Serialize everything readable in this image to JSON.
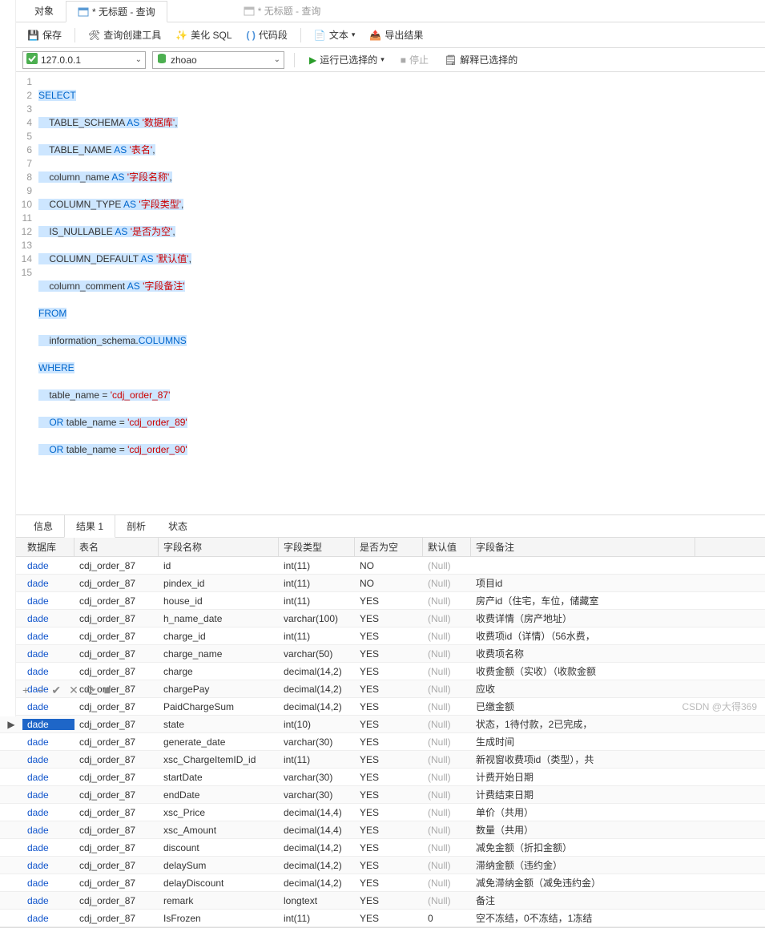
{
  "tabs": {
    "object": "对象",
    "active": "* 无标题 - 查询",
    "inactive": "* 无标题 - 查询"
  },
  "toolbar": {
    "save": "保存",
    "query_builder": "查询创建工具",
    "beautify": "美化 SQL",
    "snippet": "代码段",
    "text": "文本",
    "export": "导出结果"
  },
  "conn": {
    "host": "127.0.0.1",
    "db": "zhoao",
    "run": "运行已选择的",
    "stop": "停止",
    "explain": "解释已选择的"
  },
  "sql": {
    "l1": "SELECT",
    "l2_a": "TABLE_SCHEMA",
    "l2_b": "AS",
    "l2_c": "'数据库'",
    "l3_a": "TABLE_NAME",
    "l3_b": "AS",
    "l3_c": "'表名'",
    "l4_a": "column_name",
    "l4_b": "AS",
    "l4_c": "'字段名称'",
    "l5_a": "COLUMN_TYPE",
    "l5_b": "AS",
    "l5_c": "'字段类型'",
    "l6_a": "IS_NULLABLE",
    "l6_b": "AS",
    "l6_c": "'是否为空'",
    "l7_a": "COLUMN_DEFAULT",
    "l7_b": "AS",
    "l7_c": "'默认值'",
    "l8_a": "column_comment",
    "l8_b": "AS",
    "l8_c": "'字段备注'",
    "l9": "FROM",
    "l10_a": "information_schema",
    "l10_b": "COLUMNS",
    "l11": "WHERE",
    "l12_a": "table_name =",
    "l12_b": "'cdj_order_87'",
    "l13_a": "OR",
    "l13_b": "table_name =",
    "l13_c": "'cdj_order_89'",
    "l14_a": "OR",
    "l14_b": "table_name =",
    "l14_c": "'cdj_order_90'"
  },
  "rtabs": {
    "info": "信息",
    "result": "结果 1",
    "profile": "剖析",
    "status": "状态"
  },
  "headers": {
    "c0": "数据库",
    "c1": "表名",
    "c2": "字段名称",
    "c3": "字段类型",
    "c4": "是否为空",
    "c5": "默认值",
    "c6": "字段备注"
  },
  "null_label": "(Null)",
  "rows": [
    {
      "db": "dade",
      "t": "cdj_order_87",
      "f": "id",
      "ty": "int(11)",
      "n": "NO",
      "d": null,
      "c": ""
    },
    {
      "db": "dade",
      "t": "cdj_order_87",
      "f": "pindex_id",
      "ty": "int(11)",
      "n": "NO",
      "d": null,
      "c": "项目id"
    },
    {
      "db": "dade",
      "t": "cdj_order_87",
      "f": "house_id",
      "ty": "int(11)",
      "n": "YES",
      "d": null,
      "c": "房产id（住宅，车位，储藏室"
    },
    {
      "db": "dade",
      "t": "cdj_order_87",
      "f": "h_name_date",
      "ty": "varchar(100)",
      "n": "YES",
      "d": null,
      "c": "收费详情（房产地址）"
    },
    {
      "db": "dade",
      "t": "cdj_order_87",
      "f": "charge_id",
      "ty": "int(11)",
      "n": "YES",
      "d": null,
      "c": "收费项id（详情）（56水费，"
    },
    {
      "db": "dade",
      "t": "cdj_order_87",
      "f": "charge_name",
      "ty": "varchar(50)",
      "n": "YES",
      "d": null,
      "c": "收费项名称"
    },
    {
      "db": "dade",
      "t": "cdj_order_87",
      "f": "charge",
      "ty": "decimal(14,2)",
      "n": "YES",
      "d": null,
      "c": "收费金额（实收）（收款金额"
    },
    {
      "db": "dade",
      "t": "cdj_order_87",
      "f": "chargePay",
      "ty": "decimal(14,2)",
      "n": "YES",
      "d": null,
      "c": "应收"
    },
    {
      "db": "dade",
      "t": "cdj_order_87",
      "f": "PaidChargeSum",
      "ty": "decimal(14,2)",
      "n": "YES",
      "d": null,
      "c": "已缴金额"
    },
    {
      "db": "dade",
      "t": "cdj_order_87",
      "f": "state",
      "ty": "int(10)",
      "n": "YES",
      "d": null,
      "c": "状态，1待付款，2已完成，",
      "sel": true
    },
    {
      "db": "dade",
      "t": "cdj_order_87",
      "f": "generate_date",
      "ty": "varchar(30)",
      "n": "YES",
      "d": null,
      "c": "生成时间"
    },
    {
      "db": "dade",
      "t": "cdj_order_87",
      "f": "xsc_ChargeItemID_id",
      "ty": "int(11)",
      "n": "YES",
      "d": null,
      "c": "新视窗收费项id（类型），共"
    },
    {
      "db": "dade",
      "t": "cdj_order_87",
      "f": "startDate",
      "ty": "varchar(30)",
      "n": "YES",
      "d": null,
      "c": "计费开始日期"
    },
    {
      "db": "dade",
      "t": "cdj_order_87",
      "f": "endDate",
      "ty": "varchar(30)",
      "n": "YES",
      "d": null,
      "c": "计费结束日期"
    },
    {
      "db": "dade",
      "t": "cdj_order_87",
      "f": "xsc_Price",
      "ty": "decimal(14,4)",
      "n": "YES",
      "d": null,
      "c": "单价（共用）"
    },
    {
      "db": "dade",
      "t": "cdj_order_87",
      "f": "xsc_Amount",
      "ty": "decimal(14,4)",
      "n": "YES",
      "d": null,
      "c": "数量（共用）"
    },
    {
      "db": "dade",
      "t": "cdj_order_87",
      "f": "discount",
      "ty": "decimal(14,2)",
      "n": "YES",
      "d": null,
      "c": "减免金额（折扣金额）"
    },
    {
      "db": "dade",
      "t": "cdj_order_87",
      "f": "delaySum",
      "ty": "decimal(14,2)",
      "n": "YES",
      "d": null,
      "c": "滞纳金额（违约金）"
    },
    {
      "db": "dade",
      "t": "cdj_order_87",
      "f": "delayDiscount",
      "ty": "decimal(14,2)",
      "n": "YES",
      "d": null,
      "c": "减免滞纳金额（减免违约金）"
    },
    {
      "db": "dade",
      "t": "cdj_order_87",
      "f": "remark",
      "ty": "longtext",
      "n": "YES",
      "d": null,
      "c": "备注"
    },
    {
      "db": "dade",
      "t": "cdj_order_87",
      "f": "IsFrozen",
      "ty": "int(11)",
      "n": "YES",
      "d": "0",
      "c": "空不冻结，0不冻结，1冻结"
    }
  ],
  "watermark": "CSDN @大得369"
}
